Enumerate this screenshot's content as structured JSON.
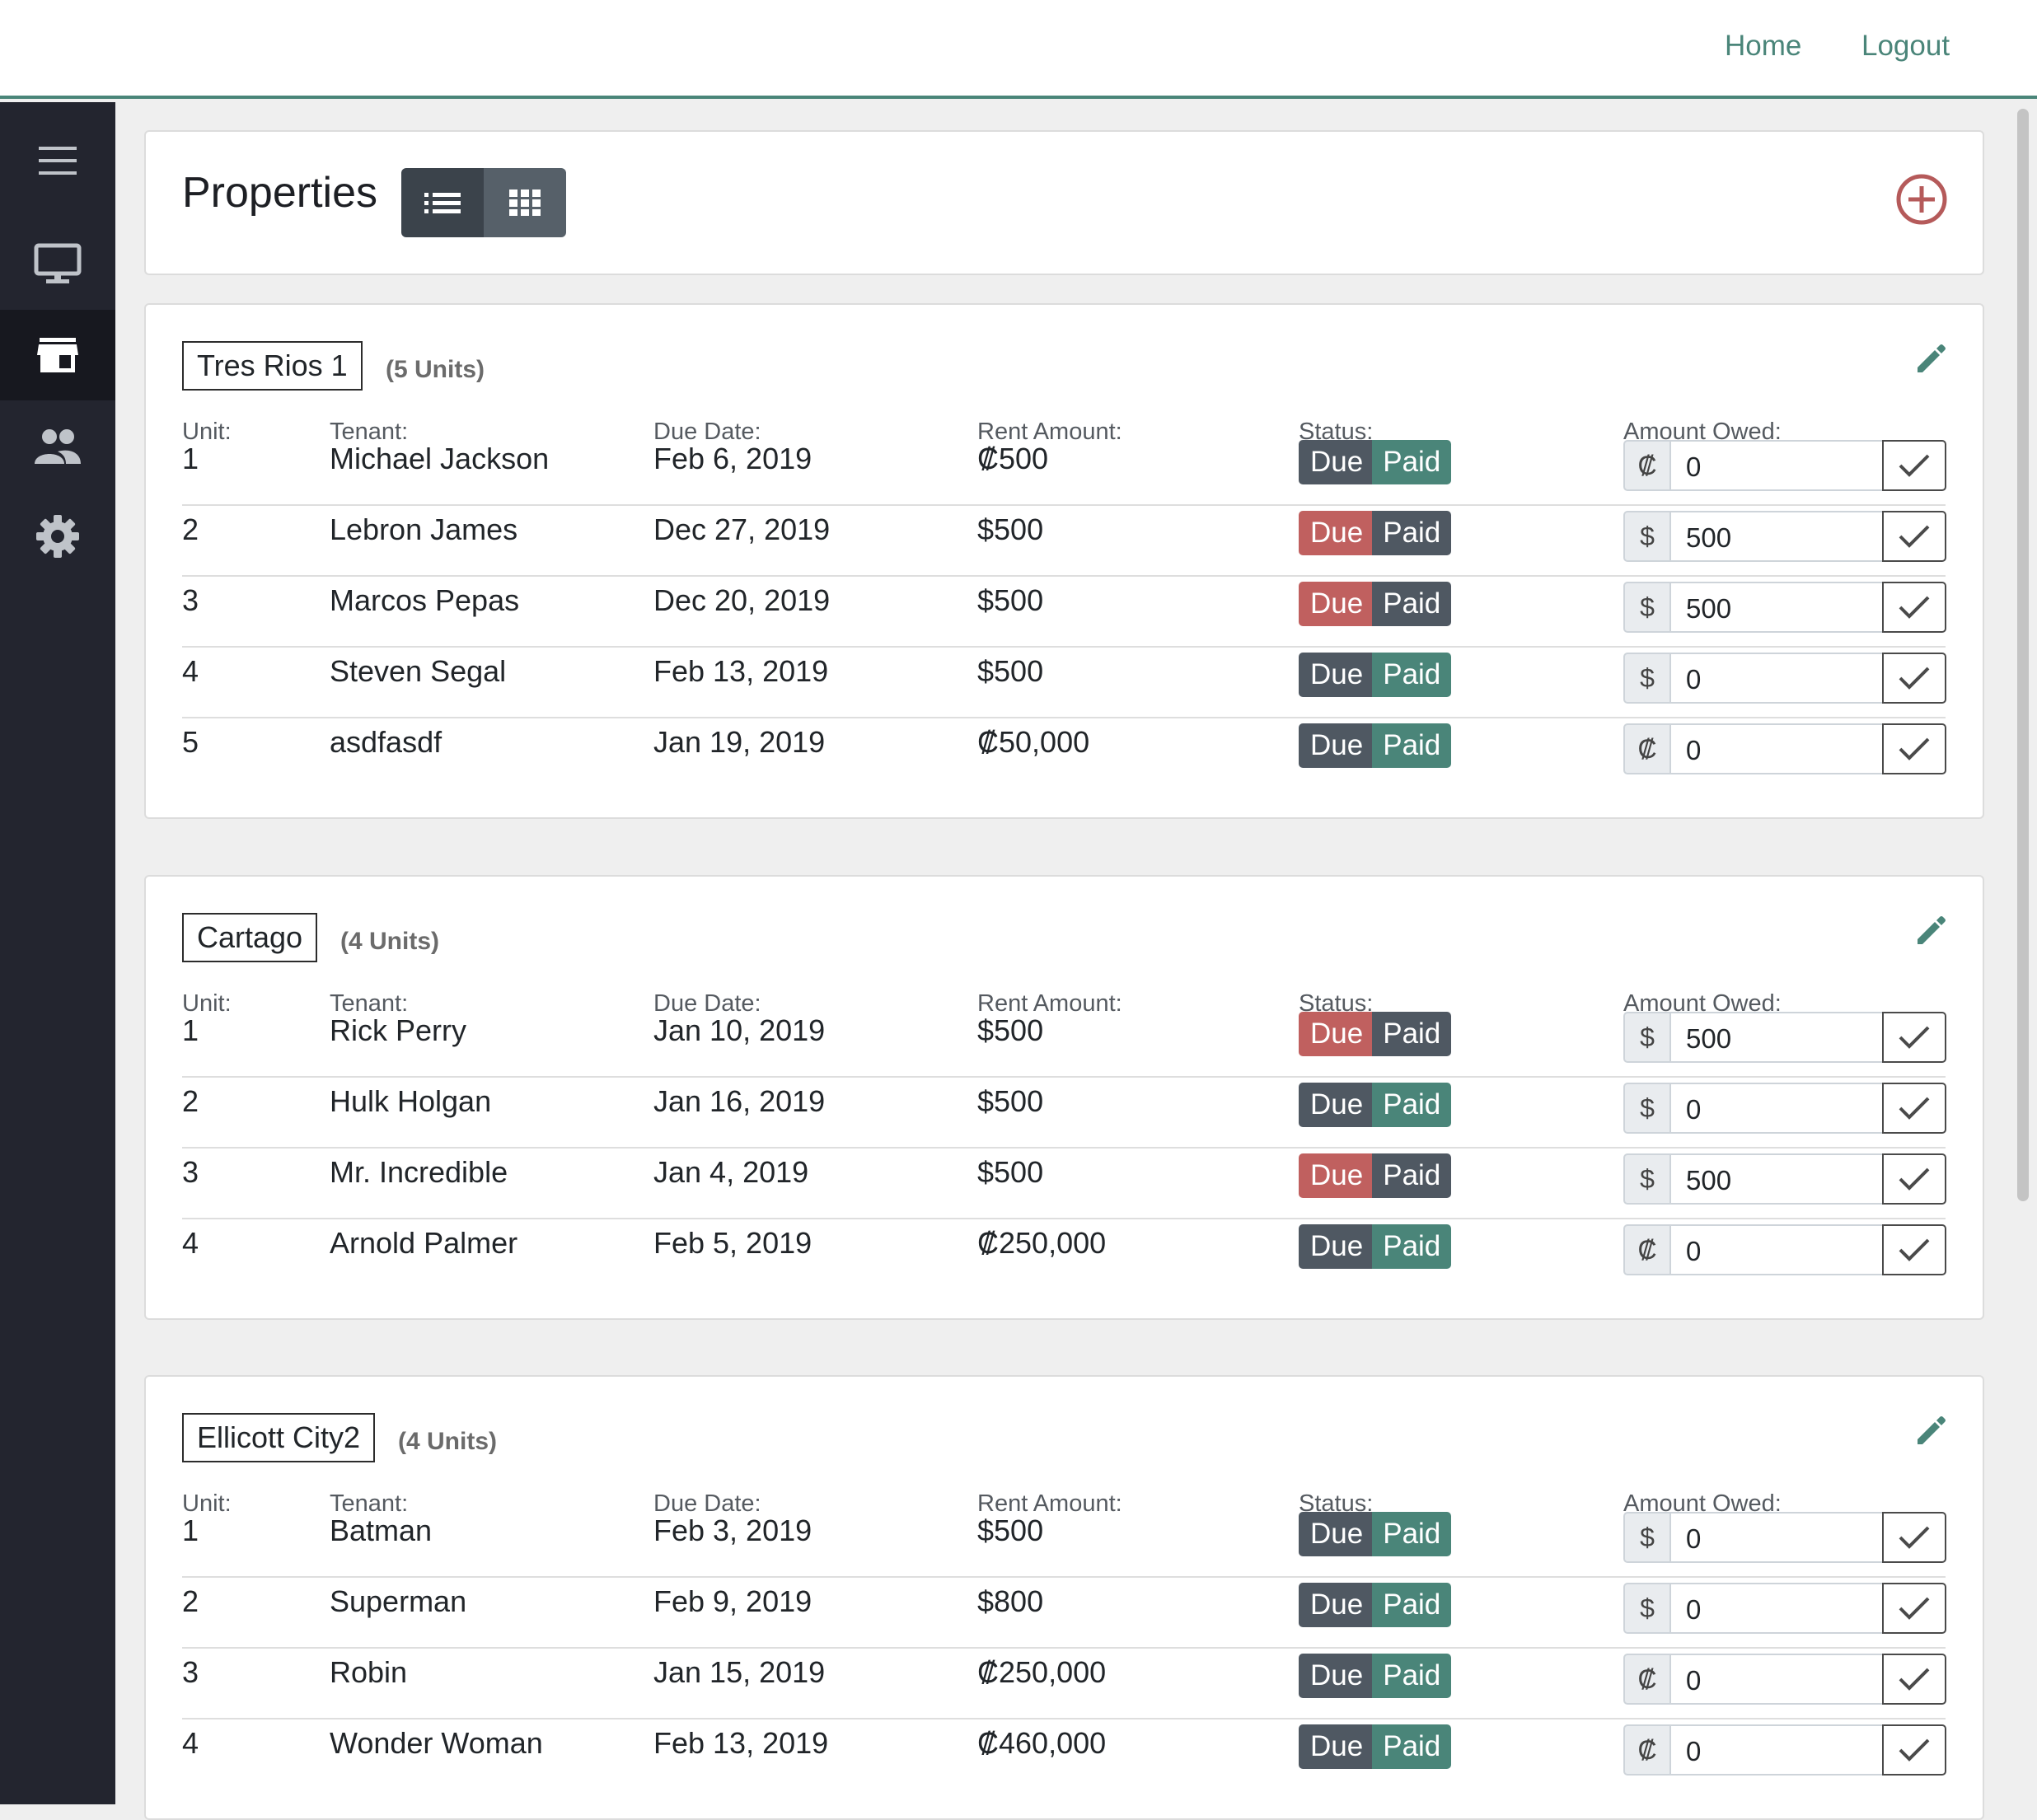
{
  "nav": {
    "home": "Home",
    "logout": "Logout"
  },
  "sidebar": {
    "items": [
      {
        "icon": "menu-icon"
      },
      {
        "icon": "monitor-icon"
      },
      {
        "icon": "store-icon",
        "active": true
      },
      {
        "icon": "people-icon"
      },
      {
        "icon": "gear-icon"
      }
    ]
  },
  "header": {
    "title": "Properties",
    "view_modes": [
      "list-view-icon",
      "grid-view-icon"
    ],
    "active_view": "list"
  },
  "columns": {
    "unit": "Unit:",
    "tenant": "Tenant:",
    "due_date": "Due Date:",
    "rent": "Rent Amount:",
    "status": "Status:",
    "owed": "Amount Owed:"
  },
  "status_labels": {
    "due": "Due",
    "paid": "Paid"
  },
  "colors": {
    "accent": "#4a8579",
    "due_active": "#c0605f",
    "paid_active": "#4a8579",
    "inactive": "#4f5862",
    "sidebar": "#23252f",
    "add": "#b55a5a"
  },
  "properties": [
    {
      "name": "Tres Rios 1",
      "units_label": "(5 Units)",
      "rows": [
        {
          "unit": "1",
          "tenant": "Michael Jackson",
          "due": "Feb 6, 2019",
          "rent": "₡500",
          "status": "paid",
          "currency": "₡",
          "owed": "0"
        },
        {
          "unit": "2",
          "tenant": "Lebron James",
          "due": "Dec 27, 2019",
          "rent": "$500",
          "status": "due",
          "currency": "$",
          "owed": "500"
        },
        {
          "unit": "3",
          "tenant": "Marcos Pepas",
          "due": "Dec 20, 2019",
          "rent": "$500",
          "status": "due",
          "currency": "$",
          "owed": "500"
        },
        {
          "unit": "4",
          "tenant": "Steven Segal",
          "due": "Feb 13, 2019",
          "rent": "$500",
          "status": "paid",
          "currency": "$",
          "owed": "0"
        },
        {
          "unit": "5",
          "tenant": "asdfasdf",
          "due": "Jan 19, 2019",
          "rent": "₡50,000",
          "status": "paid",
          "currency": "₡",
          "owed": "0"
        }
      ]
    },
    {
      "name": "Cartago",
      "units_label": "(4 Units)",
      "rows": [
        {
          "unit": "1",
          "tenant": "Rick Perry",
          "due": "Jan 10, 2019",
          "rent": "$500",
          "status": "due",
          "currency": "$",
          "owed": "500"
        },
        {
          "unit": "2",
          "tenant": "Hulk Holgan",
          "due": "Jan 16, 2019",
          "rent": "$500",
          "status": "paid",
          "currency": "$",
          "owed": "0"
        },
        {
          "unit": "3",
          "tenant": "Mr. Incredible",
          "due": "Jan 4, 2019",
          "rent": "$500",
          "status": "due",
          "currency": "$",
          "owed": "500"
        },
        {
          "unit": "4",
          "tenant": "Arnold Palmer",
          "due": "Feb 5, 2019",
          "rent": "₡250,000",
          "status": "paid",
          "currency": "₡",
          "owed": "0"
        }
      ]
    },
    {
      "name": "Ellicott City2",
      "units_label": "(4 Units)",
      "rows": [
        {
          "unit": "1",
          "tenant": "Batman",
          "due": "Feb 3, 2019",
          "rent": "$500",
          "status": "paid",
          "currency": "$",
          "owed": "0"
        },
        {
          "unit": "2",
          "tenant": "Superman",
          "due": "Feb 9, 2019",
          "rent": "$800",
          "status": "paid",
          "currency": "$",
          "owed": "0"
        },
        {
          "unit": "3",
          "tenant": "Robin",
          "due": "Jan 15, 2019",
          "rent": "₡250,000",
          "status": "paid",
          "currency": "₡",
          "owed": "0"
        },
        {
          "unit": "4",
          "tenant": "Wonder Woman",
          "due": "Feb 13, 2019",
          "rent": "₡460,000",
          "status": "paid",
          "currency": "₡",
          "owed": "0"
        }
      ]
    }
  ]
}
